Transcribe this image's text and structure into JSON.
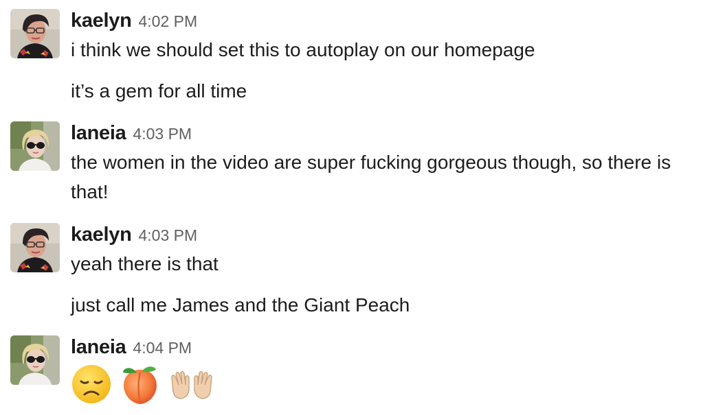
{
  "messages": [
    {
      "user": "kaelyn",
      "time": "4:02 PM",
      "avatar_icon": "kaelyn-avatar",
      "lines": [
        "i think we should set this to autoplay on our homepage",
        "it’s a gem for all time"
      ]
    },
    {
      "user": "laneia",
      "time": "4:03 PM",
      "avatar_icon": "laneia-avatar",
      "lines": [
        "the women in the video are super fucking gorgeous though, so there is that!"
      ]
    },
    {
      "user": "kaelyn",
      "time": "4:03 PM",
      "avatar_icon": "kaelyn-avatar",
      "lines": [
        "yeah there is that",
        "just call me James and the Giant Peach"
      ]
    },
    {
      "user": "laneia",
      "time": "4:04 PM",
      "avatar_icon": "laneia-avatar",
      "emojis": [
        "disappointed-face-emoji",
        "peach-emoji",
        "raised-hands-emoji"
      ]
    }
  ]
}
